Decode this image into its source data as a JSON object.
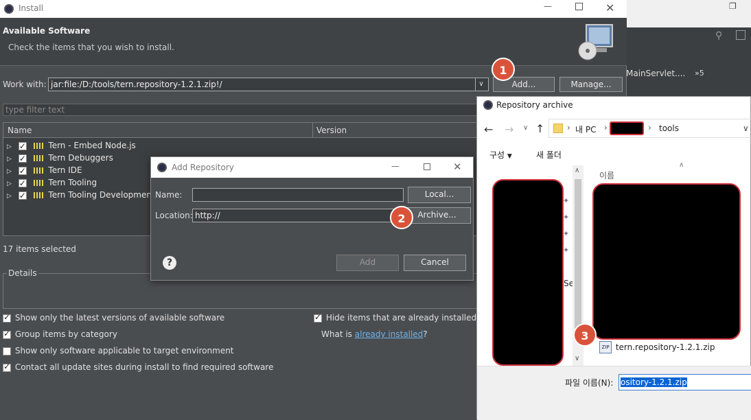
{
  "install_window": {
    "title": "Install",
    "heading": "Available Software",
    "subheading": "Check the items that you wish to install.",
    "work_with_label": "Work with:",
    "work_with_value": "jar:file:/D:/tools/tern.repository-1.2.1.zip!/",
    "add_button": "Add...",
    "manage_button": "Manage...",
    "filter_placeholder": "type filter text",
    "columns": [
      "Name",
      "Version"
    ],
    "items": [
      {
        "label": "Tern - Embed Node.js"
      },
      {
        "label": "Tern Debuggers"
      },
      {
        "label": "Tern IDE"
      },
      {
        "label": "Tern Tooling"
      },
      {
        "label": "Tern Tooling Development R"
      }
    ],
    "selected_count": "17 items selected",
    "details_label": "Details",
    "options": {
      "latest_versions": "Show only the latest versions of available software",
      "group_by_category": "Group items by category",
      "target_env": "Show only software applicable to target environment",
      "contact_sites": "Contact all update sites during install to find required software",
      "hide_installed": "Hide items that are already installed",
      "what_is_prefix": "What is ",
      "already_installed_link": "already installed",
      "what_is_suffix": "?"
    }
  },
  "background_ide": {
    "tab_label": "MainServlet....",
    "overflow_label": "»5"
  },
  "add_repository": {
    "title": "Add Repository",
    "name_label": "Name:",
    "name_value": "",
    "local_button": "Local...",
    "location_label": "Location:",
    "location_value": "http://",
    "archive_button": "Archive...",
    "add_button": "Add",
    "cancel_button": "Cancel",
    "help_symbol": "?"
  },
  "file_dialog": {
    "title": "Repository archive",
    "breadcrumb": [
      "내 PC",
      "tools"
    ],
    "organize_label": "구성",
    "new_folder_label": "새 폴더",
    "column_name": "이름",
    "file_name": "tern.repository-1.2.1.zip",
    "file_icon_text": "ZIP",
    "filename_label": "파일 이름(N):",
    "filename_value": "ository-1.2.1.zip",
    "partial_text": "Se"
  },
  "steps": [
    "1",
    "2",
    "3"
  ]
}
